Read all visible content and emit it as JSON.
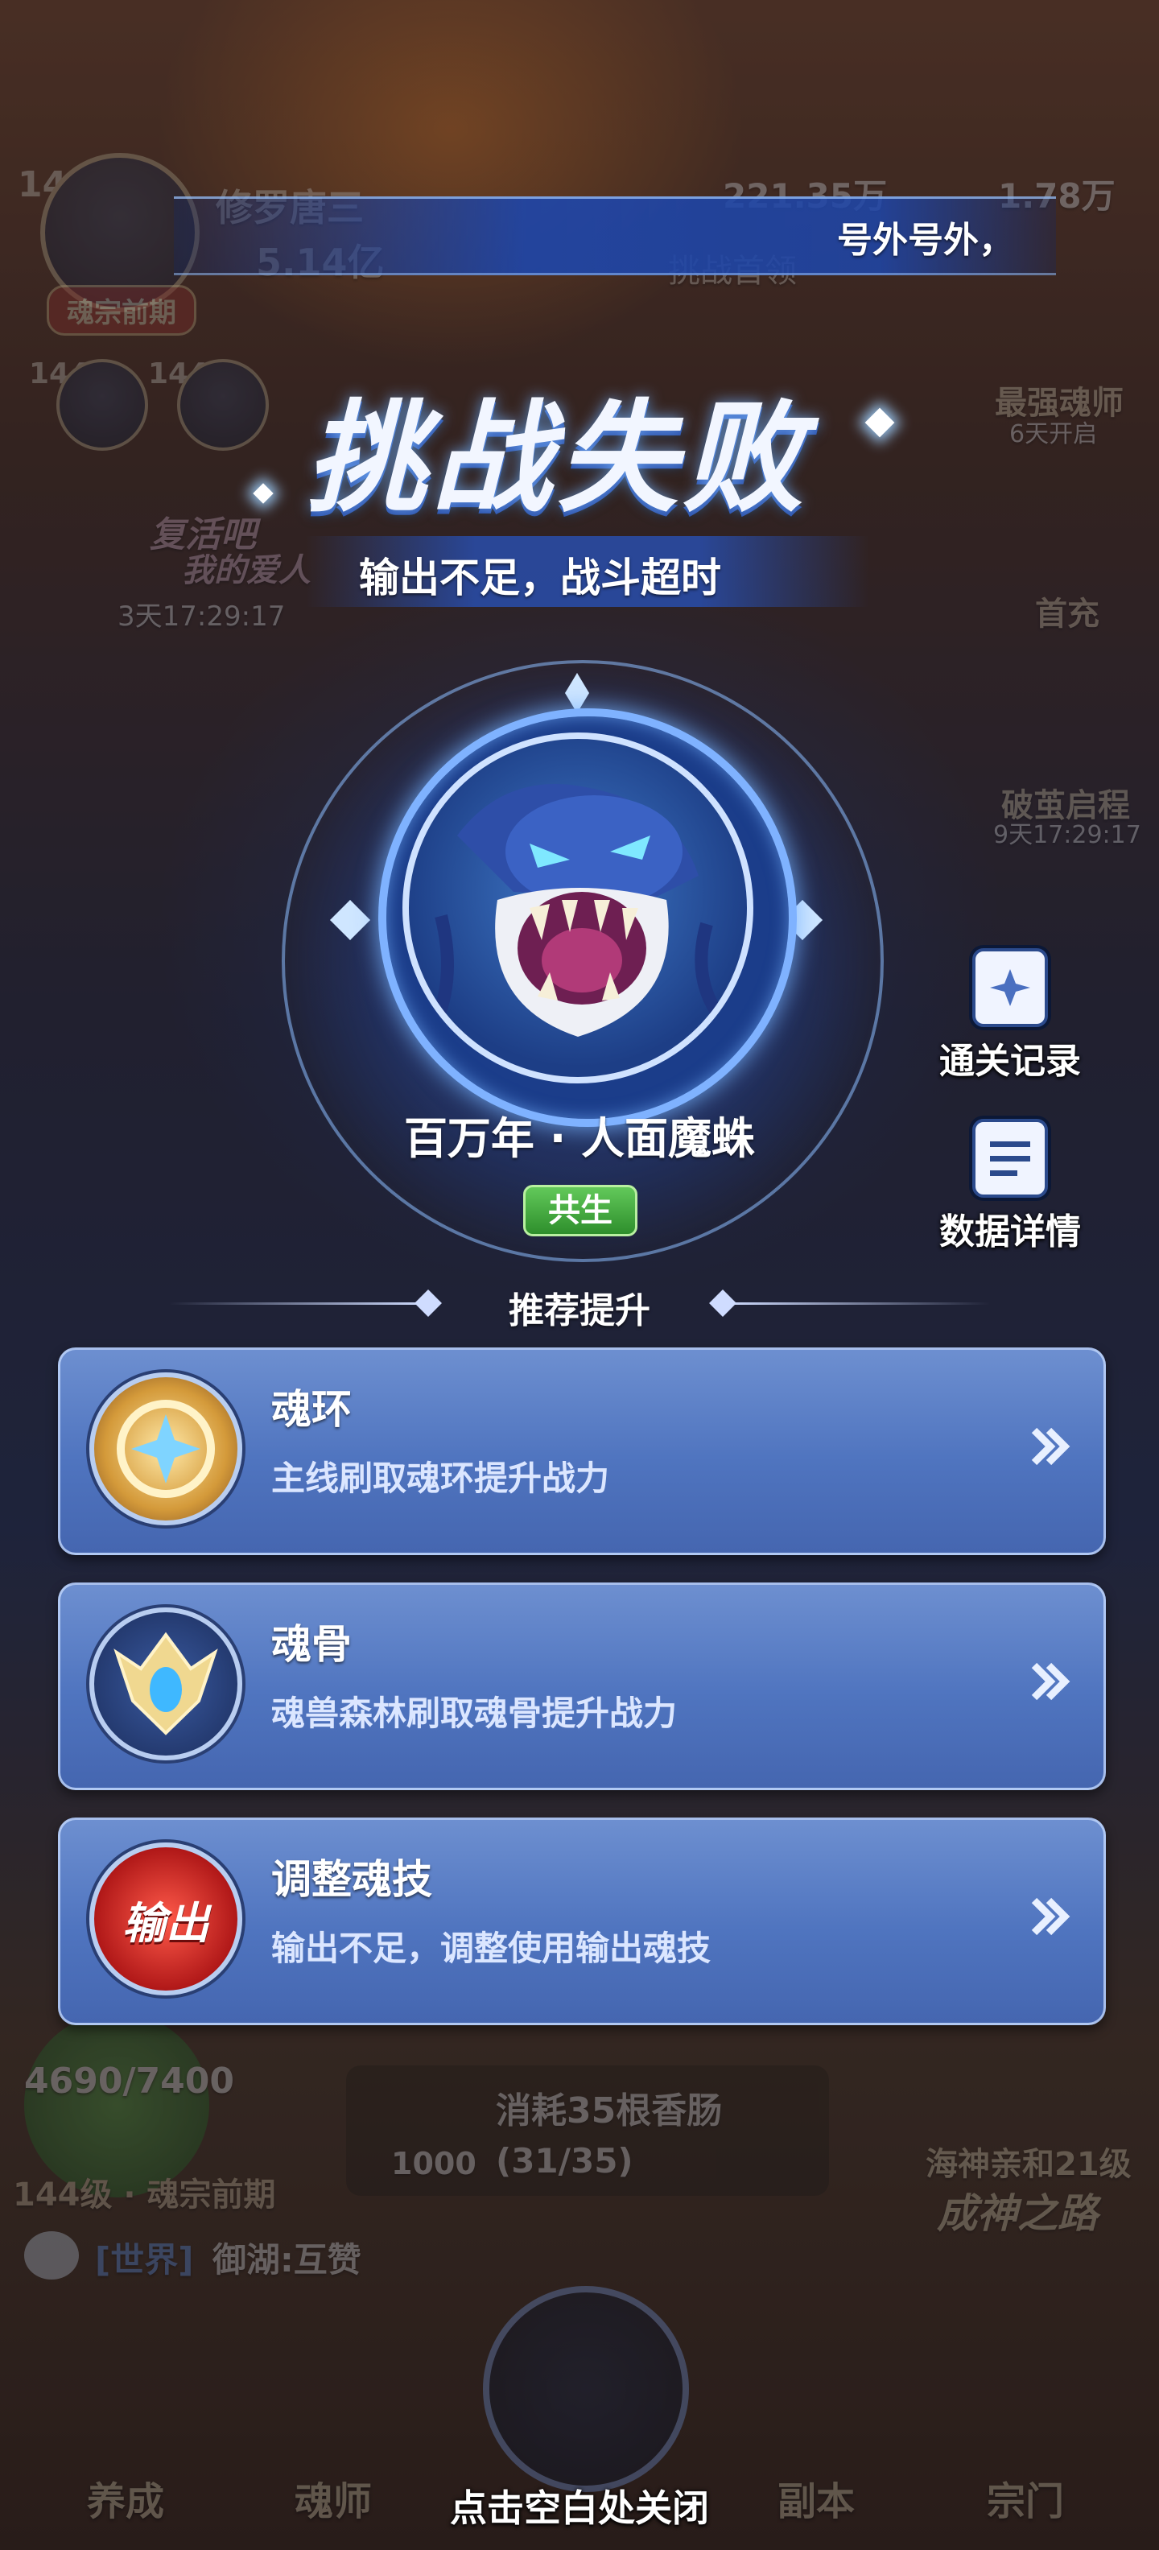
{
  "top_bar": {
    "player_level": "144",
    "player_name": "修罗唐三",
    "combat_power": "5.14亿",
    "realm": "魂宗前期",
    "gold": "221.35万",
    "diamonds": "1.78万",
    "challenge_first_kill": "挑战首领",
    "party_levels": [
      "144",
      "144"
    ]
  },
  "banner": {
    "text": "号外号外，"
  },
  "event": {
    "title_line1": "复活吧",
    "title_line2": "我的爱人",
    "timer": "3天17:29:17"
  },
  "right_menu": [
    {
      "label": "最强魂师",
      "sub": "6天开启"
    },
    {
      "label": "首充",
      "sub": ""
    },
    {
      "label": "破茧启程",
      "sub": "9天17:29:17"
    }
  ],
  "result": {
    "title": "挑战失败",
    "subtitle": "输出不足，战斗超时"
  },
  "boss": {
    "name": "百万年 · 人面魔蛛",
    "tag": "共生"
  },
  "side_buttons": {
    "clear_record": "通关记录",
    "data_details": "数据详情"
  },
  "recommend": {
    "heading": "推荐提升",
    "items": [
      {
        "title": "魂环",
        "desc": "主线刷取魂环提升战力",
        "icon": "soul-ring-icon"
      },
      {
        "title": "魂骨",
        "desc": "魂兽森林刷取魂骨提升战力",
        "icon": "soul-bone-icon"
      },
      {
        "title": "调整魂技",
        "desc": "输出不足，调整使用输出魂技",
        "icon": "output-skill-icon",
        "icon_text": "输出"
      }
    ]
  },
  "bottom_hud": {
    "hp": "4690/7400",
    "level_realm": "144级 · 魂宗前期",
    "chat_channel": "[世界]",
    "chat_message": "御湖:互赞",
    "cost_text": "消耗35根香肠",
    "cost_amount": "1000",
    "cost_progress": "(31/35)",
    "god_path_level": "海神亲和21级",
    "god_path": "成神之路"
  },
  "nav": [
    "养成",
    "魂师",
    "副本",
    "宗门"
  ],
  "close_hint": "点击空白处关闭",
  "colors": {
    "accent_blue": "#4f74bf",
    "tag_green": "#3aa83a",
    "badge_red": "#b23a30"
  }
}
